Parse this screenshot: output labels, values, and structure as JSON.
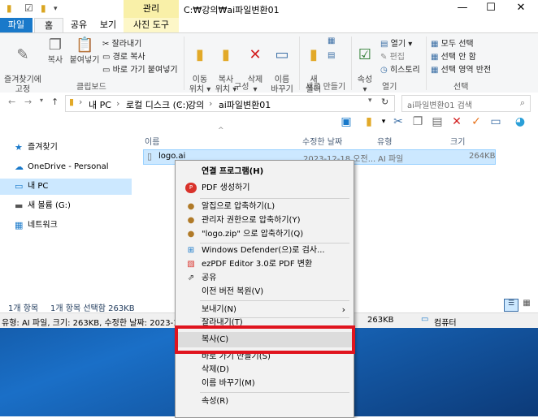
{
  "titlebar": {
    "tool_tab": "관리",
    "title": "C:₩강의₩ai파일변환01",
    "minimize": "—",
    "maximize": "☐",
    "close": "✕"
  },
  "tabs": [
    "파일",
    "홈",
    "공유",
    "보기",
    "사진 도구"
  ],
  "ribbon": {
    "pin_quick_access": "즐겨찾기에\n고정",
    "copy": "복사",
    "paste": "붙여넣기",
    "cut": "잘라내기",
    "copy_path": "경로 복사",
    "paste_shortcut": "바로 가기 붙여넣기",
    "group_clipboard": "클립보드",
    "move_to": "이동\n위치 ▾",
    "copy_to": "복사\n위치 ▾",
    "delete": "삭제\n▾",
    "rename": "이름\n바꾸기",
    "group_organize": "구성",
    "new_folder": "새\n폴더",
    "group_new": "새로 만들기",
    "properties": "속성\n▾",
    "open": "열기 ▾",
    "edit": "편집",
    "history": "히스토리",
    "group_open": "열기",
    "select_all": "모두 선택",
    "select_none": "선택 안 함",
    "invert_selection": "선택 영역 반전",
    "group_select": "선택"
  },
  "address": {
    "crumbs": [
      "내 PC",
      "로컬 디스크 (C:)",
      "강의",
      "ai파일변환01"
    ],
    "search_placeholder": "ai파일변환01 검색"
  },
  "nav": {
    "items": [
      {
        "label": "즐겨찾기",
        "icon": "star-icon"
      },
      {
        "label": "OneDrive - Personal",
        "icon": "cloud-icon"
      },
      {
        "label": "내 PC",
        "icon": "computer-icon"
      },
      {
        "label": "새 볼륨 (G:)",
        "icon": "drive-icon"
      },
      {
        "label": "네트워크",
        "icon": "network-icon"
      }
    ]
  },
  "filelist": {
    "columns": [
      "이름",
      "수정한 날짜",
      "유형",
      "크기"
    ],
    "rows": [
      {
        "name": "logo.ai",
        "date": "2023-12-18 오전...",
        "type": "AI 파일",
        "size": "264KB"
      }
    ]
  },
  "statusbar": {
    "count": "1개 항목",
    "selected": "1개 항목 선택함 263KB"
  },
  "detailsbar": {
    "info": "유형: AI 파일, 크기: 263KB, 수정한 날짜: 2023-12-18 오전",
    "size": "263KB",
    "location": "컴퓨터"
  },
  "context_menu": {
    "items": [
      {
        "label": "연결 프로그램(H)",
        "icon": ""
      },
      {
        "label": "PDF 생성하기",
        "icon": "pdf-icon"
      },
      {
        "label": "알집으로 압축하기(L)",
        "icon": "archive-icon"
      },
      {
        "label": "관리자 권한으로 압축하기(Y)",
        "icon": "archive-icon"
      },
      {
        "label": "\"logo.zip\" 으로 압축하기(Q)",
        "icon": "archive-icon"
      },
      {
        "label": "Windows Defender(으)로 검사...",
        "icon": "defender-icon"
      },
      {
        "label": "ezPDF Editor 3.0로 PDF 변환",
        "icon": "ezpdf-icon"
      },
      {
        "label": "공유",
        "icon": "share-icon"
      },
      {
        "label": "이전 버전 복원(V)",
        "icon": ""
      },
      {
        "label": "보내기(N)",
        "icon": ""
      },
      {
        "label": "잘라내기(T)",
        "icon": ""
      },
      {
        "label": "복사(C)",
        "icon": ""
      },
      {
        "label": "바로 가기 만들기(S)",
        "icon": ""
      },
      {
        "label": "삭제(D)",
        "icon": ""
      },
      {
        "label": "이름 바꾸기(M)",
        "icon": ""
      },
      {
        "label": "속성(R)",
        "icon": ""
      }
    ]
  },
  "colors": {
    "file_tab": "#1979ca",
    "selection": "#cce8ff",
    "highlight_box": "#e0141e"
  }
}
